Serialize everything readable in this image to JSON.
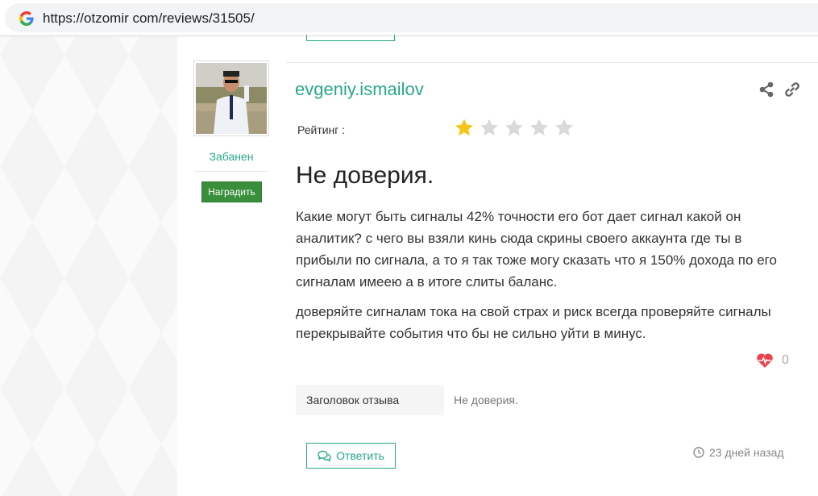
{
  "browser": {
    "url": "https://otzomir com/reviews/31505/",
    "icon": "google-g-icon"
  },
  "user": {
    "username": "evgeniy.ismailov",
    "status": "Забанен",
    "award_label": "Наградить",
    "avatar_icon": "user-photo"
  },
  "review": {
    "rating_label": "Рейтинг :",
    "rating": 1,
    "rating_max": 5,
    "title": "Не доверия.",
    "paragraphs": [
      "Какие могут быть сигналы 42% точности его бот дает сигнал какой он аналитик? с чего вы взяли кинь сюда скрины своего аккаунта где ты в прибыли по сигнала, а то я так тоже могу сказать что я 150% дохода по его сигналам имеею а в итоге слиты баланс.",
      "доверяйте сигналам тока на свой страх и риск всегда проверяйте сигналы перекрывайте события что бы не сильно уйти в минус."
    ],
    "likes": "0",
    "attributes": [
      {
        "name": "Заголовок отзыва",
        "value": "Не доверия."
      }
    ],
    "reply_label": "Ответить",
    "time_ago": "23 дней назад"
  },
  "colors": {
    "accent": "#27a88a",
    "star_filled": "#f5c518",
    "star_empty": "#d9d9d9",
    "heart": "#e8434f",
    "award_bg": "#3a8f3c"
  }
}
